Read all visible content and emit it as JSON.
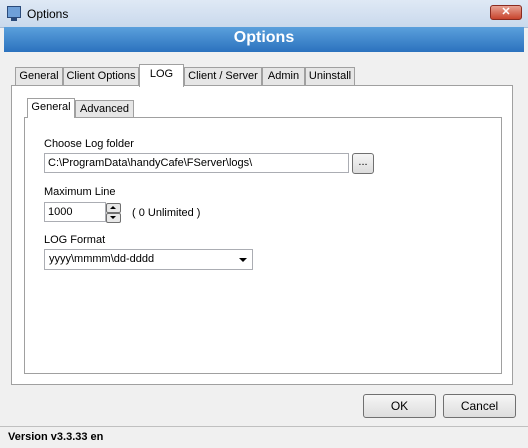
{
  "window": {
    "title": "Options",
    "close_glyph": "✕"
  },
  "banner": {
    "title": "Options"
  },
  "tabs": [
    {
      "label": "General"
    },
    {
      "label": "Client Options"
    },
    {
      "label": "LOG"
    },
    {
      "label": "Client / Server"
    },
    {
      "label": "Admin"
    },
    {
      "label": "Uninstall"
    }
  ],
  "active_tab": "LOG",
  "subtabs": [
    {
      "label": "General"
    },
    {
      "label": "Advanced"
    }
  ],
  "active_subtab": "General",
  "log": {
    "folder_label": "Choose Log folder",
    "folder_value": "C:\\ProgramData\\handyCafe\\FServer\\logs\\",
    "browse_label": "...",
    "max_line_label": "Maximum Line",
    "max_line_value": "1000",
    "max_line_hint": "( 0 Unlimited )",
    "format_label": "LOG Format",
    "format_value": "yyyy\\mmmm\\dd-dddd"
  },
  "buttons": {
    "ok": "OK",
    "cancel": "Cancel"
  },
  "status": {
    "version": "Version v3.3.33 en"
  },
  "icons": [
    "app-icon",
    "close-icon",
    "spin-up-icon",
    "spin-down-icon",
    "dropdown-arrow-icon"
  ]
}
